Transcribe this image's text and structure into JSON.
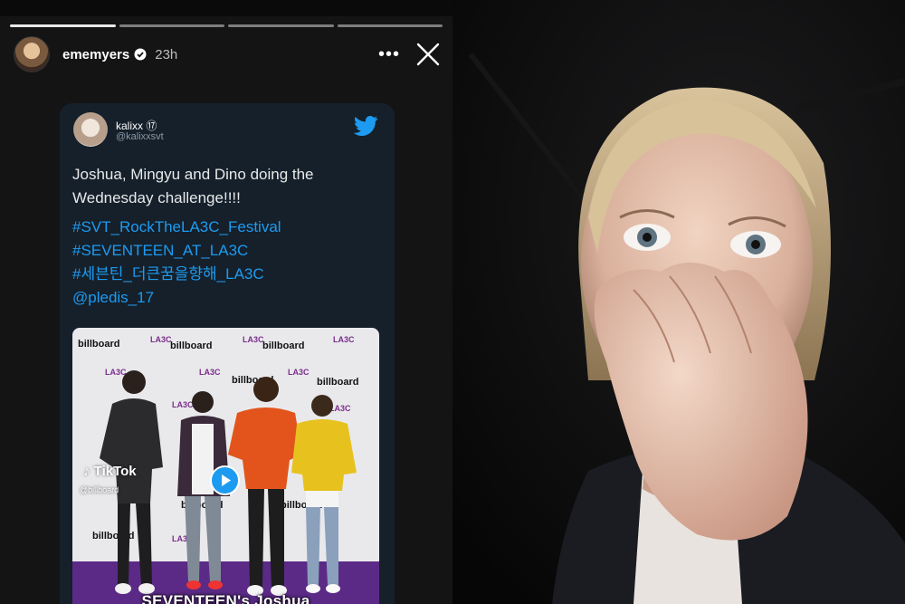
{
  "story": {
    "username": "ememyers",
    "time": "23h",
    "progress_segments": 4,
    "active_segment": 0
  },
  "tweet": {
    "name": "kalixx ⑰",
    "handle": "@kalixxsvt",
    "text": "Joshua, Mingyu and Dino doing the Wednesday challenge!!!!",
    "hashtags": [
      "#SVT_RockTheLA3C_Festival",
      "#SEVENTEEN_AT_LA3C",
      "#세븐틴_더큰꿈을향해_LA3C",
      "@pledis_17"
    ],
    "media": {
      "tiktok_label": "TikTok",
      "tiktok_handle": "@billboard",
      "caption": "SEVENTEEN's Joshua",
      "backdrop_brand": "billboard",
      "backdrop_mark": "LA3C"
    }
  },
  "colors": {
    "tweet_bg": "#15202b",
    "link": "#1d9bf0",
    "story_bg": "#141414"
  }
}
